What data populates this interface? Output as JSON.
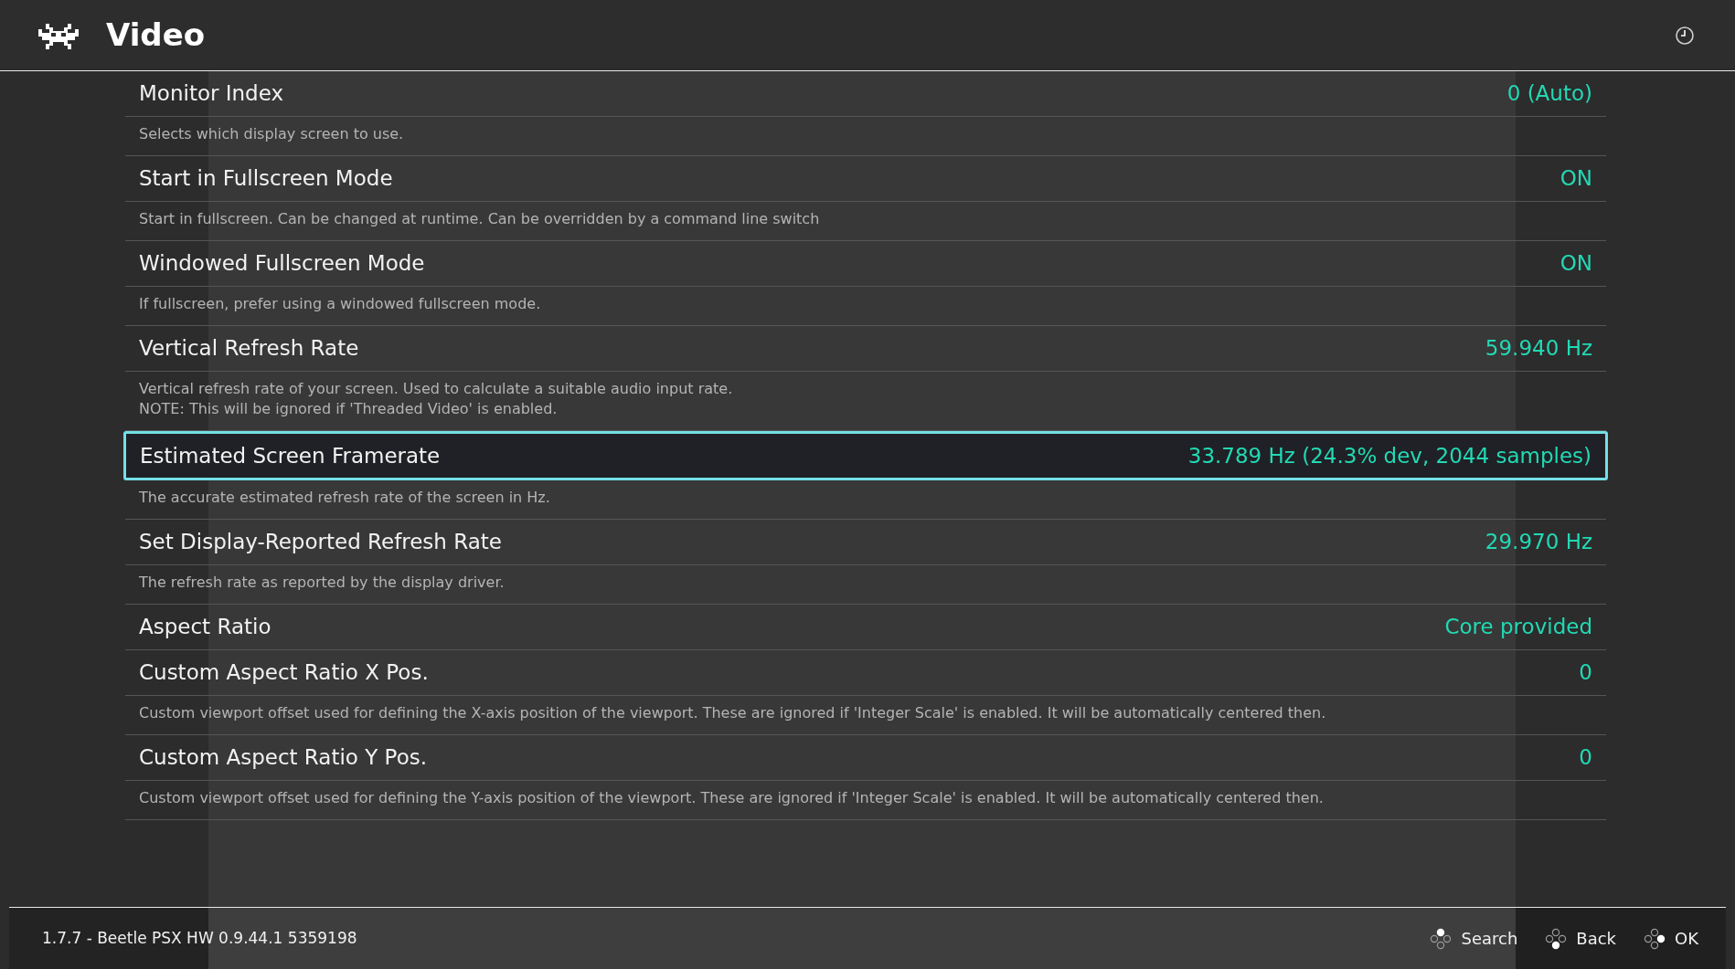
{
  "header": {
    "title": "Video"
  },
  "settings": [
    {
      "title": "Monitor Index",
      "value": "0 (Auto)",
      "description": [
        "Selects which display screen to use."
      ],
      "selected": false
    },
    {
      "title": "Start in Fullscreen Mode",
      "value": "ON",
      "description": [
        "Start in fullscreen. Can be changed at runtime. Can be overridden by a command line switch"
      ],
      "selected": false
    },
    {
      "title": "Windowed Fullscreen Mode",
      "value": "ON",
      "description": [
        "If fullscreen, prefer using a windowed fullscreen mode."
      ],
      "selected": false
    },
    {
      "title": "Vertical Refresh Rate",
      "value": "59.940 Hz",
      "description": [
        "Vertical refresh rate of your screen. Used to calculate a suitable audio input rate.",
        "NOTE: This will be ignored if 'Threaded Video' is enabled."
      ],
      "selected": false
    },
    {
      "title": "Estimated Screen Framerate",
      "value": "33.789 Hz (24.3% dev, 2044 samples)",
      "description": [
        "The accurate estimated refresh rate of the screen in Hz."
      ],
      "selected": true
    },
    {
      "title": "Set Display-Reported Refresh Rate",
      "value": "29.970 Hz",
      "description": [
        "The refresh rate as reported by the display driver."
      ],
      "selected": false
    },
    {
      "title": "Aspect Ratio",
      "value": "Core provided",
      "selected": false
    },
    {
      "title": "Custom Aspect Ratio X Pos.",
      "value": "0",
      "description": [
        "Custom viewport offset used for defining the X-axis position of the viewport. These are ignored if 'Integer Scale' is enabled. It will be automatically centered then."
      ],
      "selected": false
    },
    {
      "title": "Custom Aspect Ratio Y Pos.",
      "value": "0",
      "description": [
        "Custom viewport offset used for defining the Y-axis position of the viewport. These are ignored if 'Integer Scale' is enabled. It will be automatically centered then."
      ],
      "selected": false
    }
  ],
  "footer": {
    "version": "1.7.7 - Beetle PSX HW 0.9.44.1 5359198",
    "buttons": [
      {
        "label": "Search",
        "kind": "top"
      },
      {
        "label": "Back",
        "kind": "bottom"
      },
      {
        "label": "OK",
        "kind": "right"
      }
    ]
  }
}
